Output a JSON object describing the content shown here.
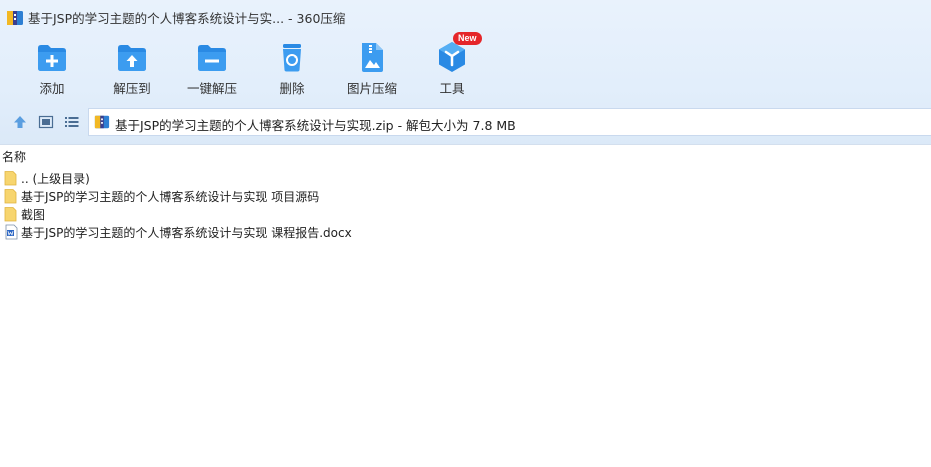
{
  "window": {
    "title": "基于JSP的学习主题的个人博客系统设计与实... - 360压缩"
  },
  "toolbar": {
    "items": [
      {
        "label": "添加",
        "icon": "add-folder-icon"
      },
      {
        "label": "解压到",
        "icon": "extract-to-icon"
      },
      {
        "label": "一键解压",
        "icon": "one-click-extract-icon"
      },
      {
        "label": "删除",
        "icon": "delete-icon"
      },
      {
        "label": "图片压缩",
        "icon": "image-compress-icon"
      },
      {
        "label": "工具",
        "icon": "tools-icon"
      }
    ],
    "new_badge": "New"
  },
  "navbar": {
    "address": "基于JSP的学习主题的个人博客系统设计与实现.zip - 解包大小为 7.8 MB"
  },
  "file_list": {
    "column_name": "名称",
    "rows": [
      {
        "name": ".. (上级目录)",
        "icon": "folder-icon"
      },
      {
        "name": "基于JSP的学习主题的个人博客系统设计与实现 项目源码",
        "icon": "folder-icon"
      },
      {
        "name": "截图",
        "icon": "folder-icon"
      },
      {
        "name": "基于JSP的学习主题的个人博客系统设计与实现 课程报告.docx",
        "icon": "word-document-icon"
      }
    ]
  },
  "colors": {
    "accent": "#2e8be6",
    "toolbar_bg": "#e2eefb",
    "badge": "#e5262a"
  }
}
